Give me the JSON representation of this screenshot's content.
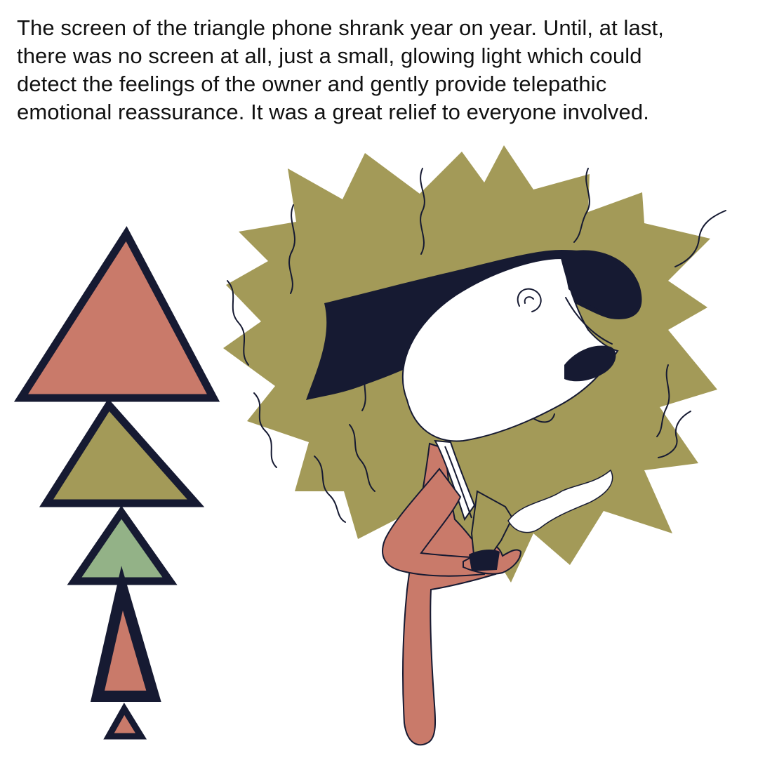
{
  "caption": {
    "line1": "The screen of the triangle phone shrank year on year. Until, at last,",
    "line2": "there was no screen at all, just a small, glowing light which could",
    "line3": "detect the feelings of the owner and gently provide telepathic",
    "line4": "emotional reassurance. It was a great relief to everyone involved."
  },
  "palette": {
    "ink": "#161a32",
    "terracotta": "#c97a6a",
    "olive": "#a39a58",
    "sage": "#93b287",
    "paper": "#ffffff"
  },
  "scene": {
    "phones": [
      {
        "name": "large-terracotta-triangle-phone",
        "color": "#c97a6a"
      },
      {
        "name": "olive-triangle-phone",
        "color": "#a39a58"
      },
      {
        "name": "sage-triangle-phone",
        "color": "#93b287"
      },
      {
        "name": "narrow-terracotta-triangle-phone",
        "color": "#c97a6a"
      },
      {
        "name": "tiny-triangle-phone",
        "color": "#c97a6a"
      }
    ],
    "figure": "person-holding-glowing-phone",
    "glow": "olive-starburst-glow"
  }
}
